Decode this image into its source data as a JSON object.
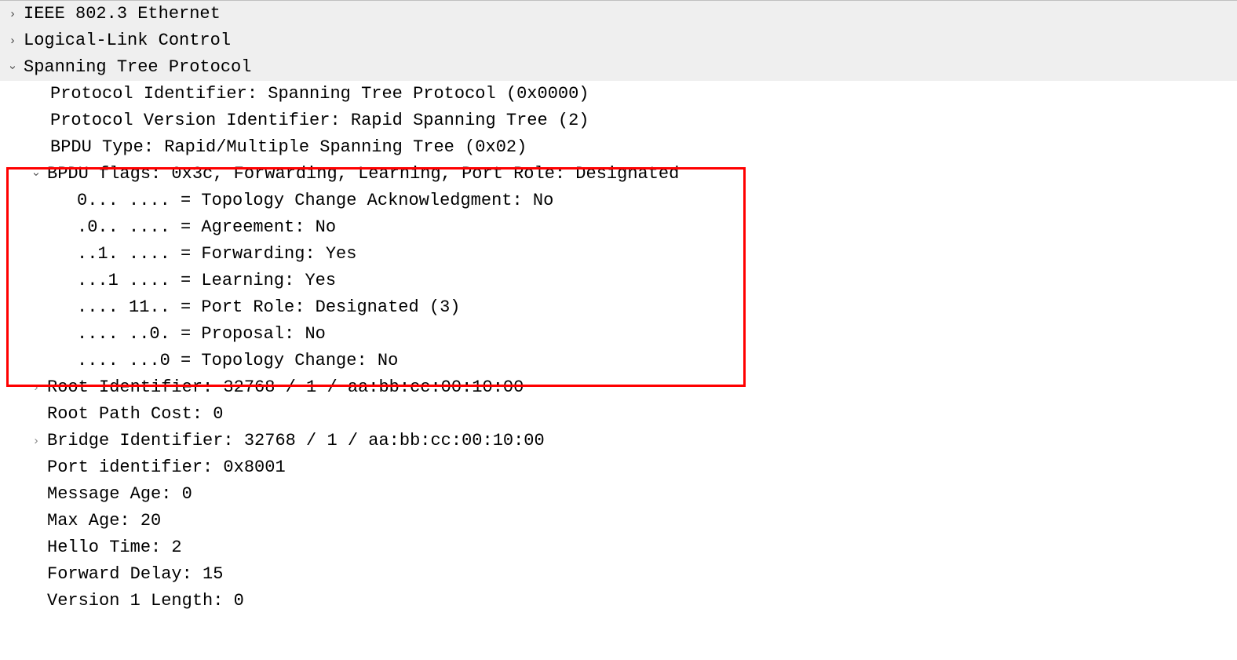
{
  "rows": {
    "ethernet": "IEEE 802.3 Ethernet",
    "llc": "Logical-Link Control",
    "stp": "Spanning Tree Protocol",
    "proto_id": "Protocol Identifier: Spanning Tree Protocol (0x0000)",
    "proto_ver": "Protocol Version Identifier: Rapid Spanning Tree (2)",
    "bpdu_type": "BPDU Type: Rapid/Multiple Spanning Tree (0x02)",
    "bpdu_flags": "BPDU flags: 0x3c, Forwarding, Learning, Port Role: Designated",
    "flag_tca": "0... .... = Topology Change Acknowledgment: No",
    "flag_agree": ".0.. .... = Agreement: No",
    "flag_fwd": "..1. .... = Forwarding: Yes",
    "flag_learn": "...1 .... = Learning: Yes",
    "flag_role": ".... 11.. = Port Role: Designated (3)",
    "flag_prop": ".... ..0. = Proposal: No",
    "flag_tc": ".... ...0 = Topology Change: No",
    "root_id": "Root Identifier: 32768 / 1 / aa:bb:cc:00:10:00",
    "root_cost": "Root Path Cost: 0",
    "bridge_id": "Bridge Identifier: 32768 / 1 / aa:bb:cc:00:10:00",
    "port_id": "Port identifier: 0x8001",
    "msg_age": "Message Age: 0",
    "max_age": "Max Age: 20",
    "hello": "Hello Time: 2",
    "fwd_delay": "Forward Delay: 15",
    "ver1_len": "Version 1 Length: 0"
  },
  "glyphs": {
    "collapsed": "❯",
    "expanded": "❯"
  }
}
